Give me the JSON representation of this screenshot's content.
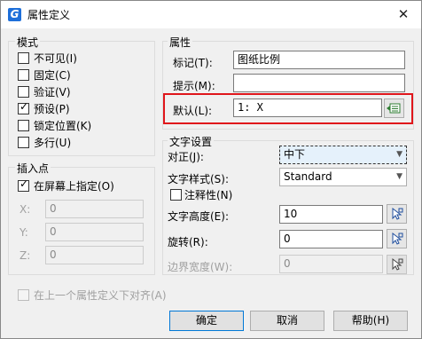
{
  "window": {
    "title": "属性定义",
    "close_glyph": "✕",
    "app_icon_letter": "G"
  },
  "mode_group": {
    "title": "模式",
    "options": [
      {
        "label": "不可见(I)",
        "checked": false
      },
      {
        "label": "固定(C)",
        "checked": false
      },
      {
        "label": "验证(V)",
        "checked": false
      },
      {
        "label": "预设(P)",
        "checked": true
      },
      {
        "label": "锁定位置(K)",
        "checked": false
      },
      {
        "label": "多行(U)",
        "checked": false
      }
    ]
  },
  "insert_group": {
    "title": "插入点",
    "on_screen_label": "在屏幕上指定(O)",
    "on_screen_checked": true,
    "x_label": "X:",
    "x_value": "0",
    "y_label": "Y:",
    "y_value": "0",
    "z_label": "Z:",
    "z_value": "0"
  },
  "attribute_group": {
    "title": "属性",
    "tag_label": "标记(T):",
    "tag_value": "图纸比例",
    "prompt_label": "提示(M):",
    "prompt_value": "",
    "default_label": "默认(L):",
    "default_value": "1: X",
    "highlight_color": "#e0161b"
  },
  "text_group": {
    "title": "文字设置",
    "justify_label": "对正(J):",
    "justify_value": "中下",
    "style_label": "文字样式(S):",
    "style_value": "Standard",
    "annotative_label": "注释性(N)",
    "annotative_checked": false,
    "height_label": "文字高度(E):",
    "height_value": "10",
    "rotation_label": "旋转(R):",
    "rotation_value": "0",
    "width_label": "边界宽度(W):",
    "width_value": "0"
  },
  "align_below": {
    "label": "在上一个属性定义下对齐(A)",
    "checked": false,
    "enabled": false
  },
  "buttons": {
    "ok": "确定",
    "cancel": "取消",
    "help": "帮助(H)"
  }
}
